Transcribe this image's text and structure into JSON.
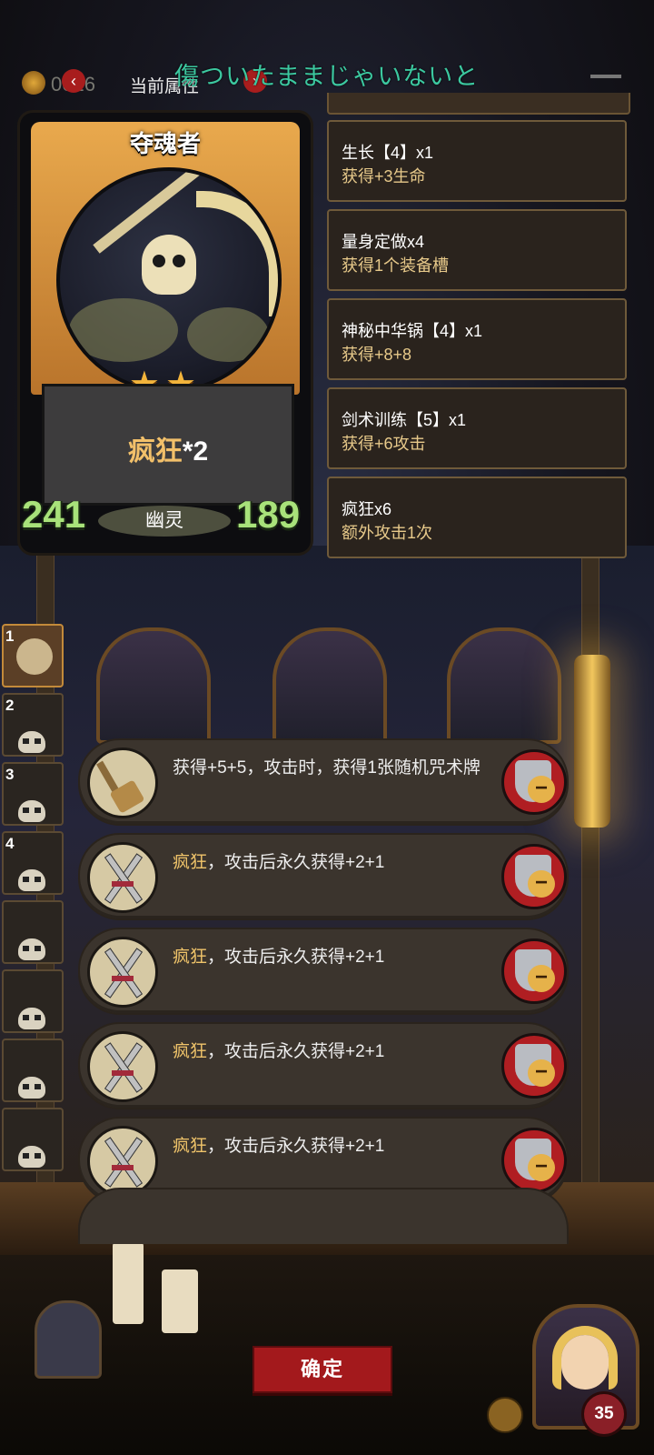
{
  "topbar": {
    "coin_value": "0016",
    "current_attr_label": "当前属性",
    "prev_arrow": "‹",
    "next_arrow": "›",
    "overlay_text": "傷ついたままじゃいないと"
  },
  "card": {
    "name": "夺魂者",
    "stars": "★★",
    "description_keyword": "疯狂",
    "description_rest": "*2",
    "attack": "241",
    "health": "189",
    "race": "幽灵"
  },
  "attributes": [
    {
      "name": "生长【4】x1",
      "effect": "获得+3生命"
    },
    {
      "name": "量身定做x4",
      "effect": "获得1个装备槽"
    },
    {
      "name": "神秘中华锅【4】x1",
      "effect": "获得+8+8"
    },
    {
      "name": "剑术训练【5】x1",
      "effect": "获得+6攻击"
    },
    {
      "name": "疯狂x6",
      "effect": "额外攻击1次"
    }
  ],
  "side_tabs": [
    {
      "num": "1"
    },
    {
      "num": "2"
    },
    {
      "num": "3"
    },
    {
      "num": "4"
    },
    {
      "num": ""
    },
    {
      "num": ""
    },
    {
      "num": ""
    },
    {
      "num": ""
    }
  ],
  "modifiers": [
    {
      "icon": "broom-icon",
      "keyword": "",
      "text": "获得+5+5，攻击时，获得1张随机咒术牌"
    },
    {
      "icon": "crossed-swords-icon",
      "keyword": "疯狂",
      "text": "，攻击后永久获得+2+1"
    },
    {
      "icon": "crossed-swords-icon",
      "keyword": "疯狂",
      "text": "，攻击后永久获得+2+1"
    },
    {
      "icon": "crossed-swords-icon",
      "keyword": "疯狂",
      "text": "，攻击后永久获得+2+1"
    },
    {
      "icon": "crossed-swords-icon",
      "keyword": "疯狂",
      "text": "，攻击后永久获得+2+1"
    }
  ],
  "remove_symbol": "−",
  "bottom": {
    "confirm_label": "确定",
    "hero_level": "35"
  },
  "colors": {
    "accent_red": "#a3191c",
    "keyword_gold": "#f0c46a",
    "stat_green": "#a8e27a",
    "overlay_teal": "#3cc8a0"
  }
}
